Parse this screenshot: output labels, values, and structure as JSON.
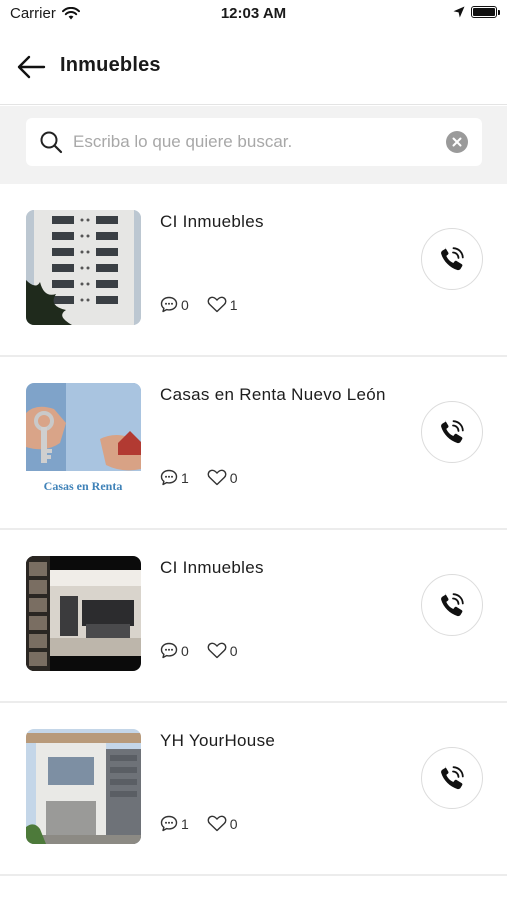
{
  "status_bar": {
    "carrier": "Carrier",
    "time": "12:03 AM"
  },
  "header": {
    "title": "Inmuebles",
    "back_icon": "arrow-left-icon"
  },
  "search": {
    "placeholder": "Escriba lo que quiere buscar.",
    "value": ""
  },
  "items": [
    {
      "title": "CI Inmuebles",
      "comments": "0",
      "likes": "1",
      "thumb": "building-facade"
    },
    {
      "title": "Casas en Renta Nuevo León",
      "comments": "1",
      "likes": "0",
      "thumb": "keys-hand",
      "thumb_caption": "Casas en Renta"
    },
    {
      "title": "CI Inmuebles",
      "comments": "0",
      "likes": "0",
      "thumb": "interior-kitchen"
    },
    {
      "title": "YH YourHouse",
      "comments": "1",
      "likes": "0",
      "thumb": "modern-house"
    }
  ],
  "colors": {
    "separator": "#ececec",
    "search_bg": "#f2f2f2",
    "clear_button": "#9a9a9a"
  }
}
